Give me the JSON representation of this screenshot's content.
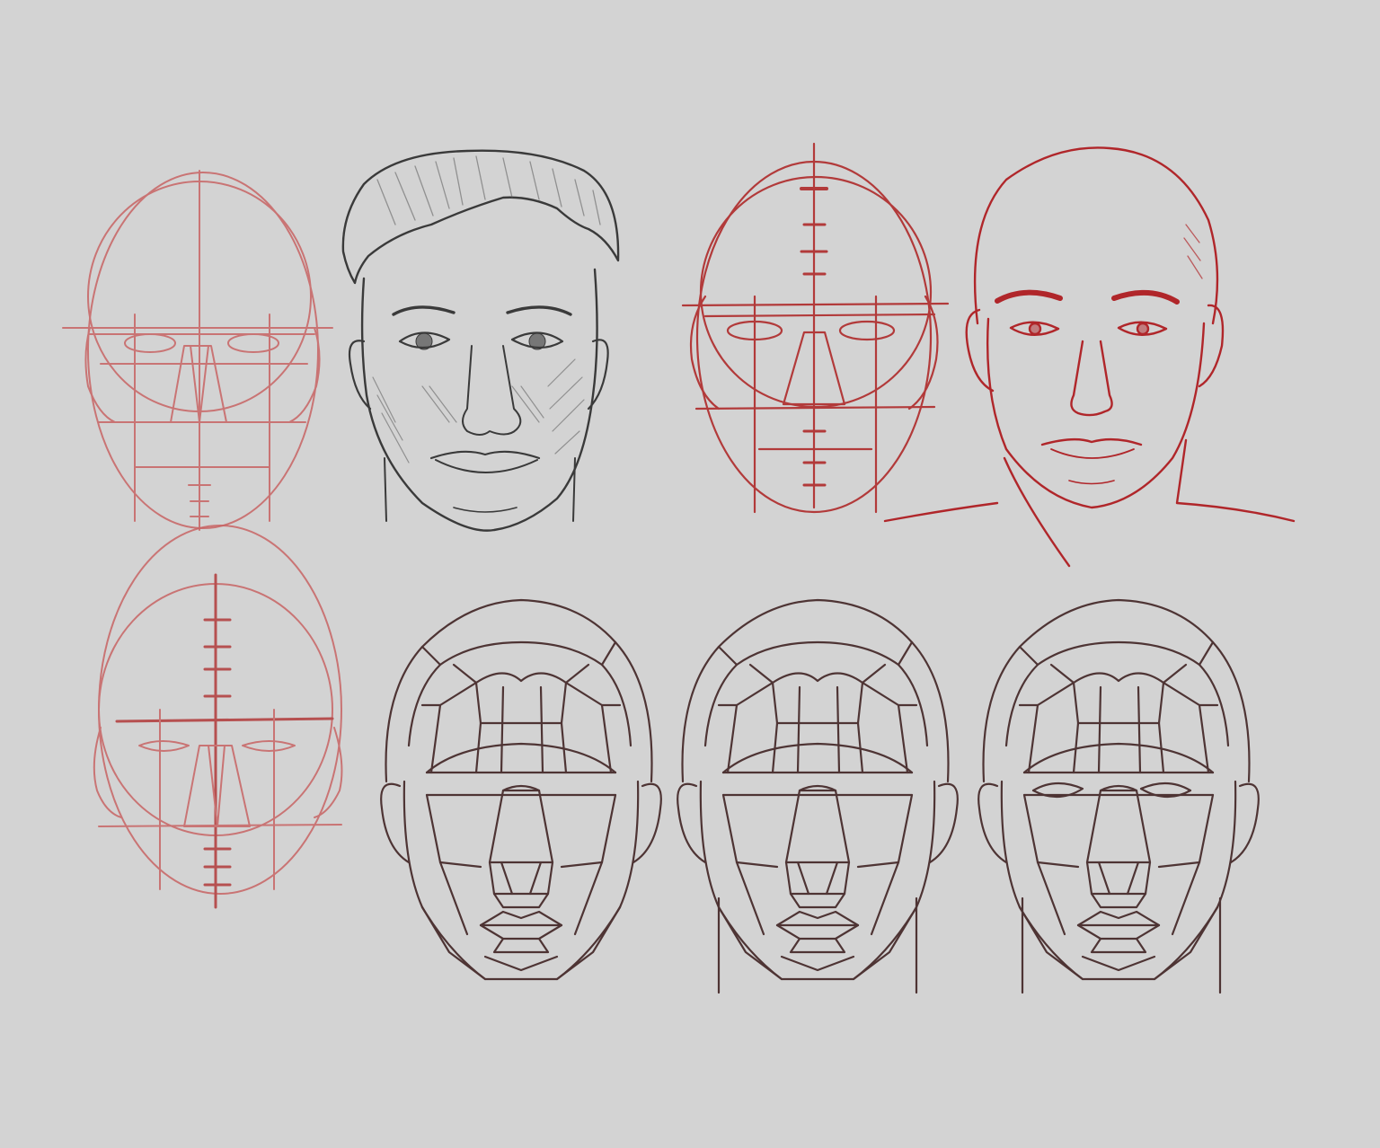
{
  "canvas": {
    "background": "#d3d3d3"
  },
  "colors": {
    "construction_red": "#b23a3a",
    "construction_red_light": "#c86464",
    "finished_red": "#b0262a",
    "pencil_graphite": "#3a3a3a",
    "planes_brown": "#4e3434"
  },
  "drawings": [
    {
      "id": "head-construction-light",
      "style": "red construction lines"
    },
    {
      "id": "head-finished-pencil",
      "style": "graphite rendered face with hair"
    },
    {
      "id": "head-construction-red",
      "style": "red construction lines"
    },
    {
      "id": "head-finished-red",
      "style": "red line bald head with shoulders"
    },
    {
      "id": "head-construction-lower",
      "style": "red construction lines"
    },
    {
      "id": "head-planes-1",
      "style": "brown planes of the head"
    },
    {
      "id": "head-planes-2",
      "style": "brown planes of the head"
    },
    {
      "id": "head-planes-3",
      "style": "brown planes of the head with eye sockets"
    }
  ]
}
